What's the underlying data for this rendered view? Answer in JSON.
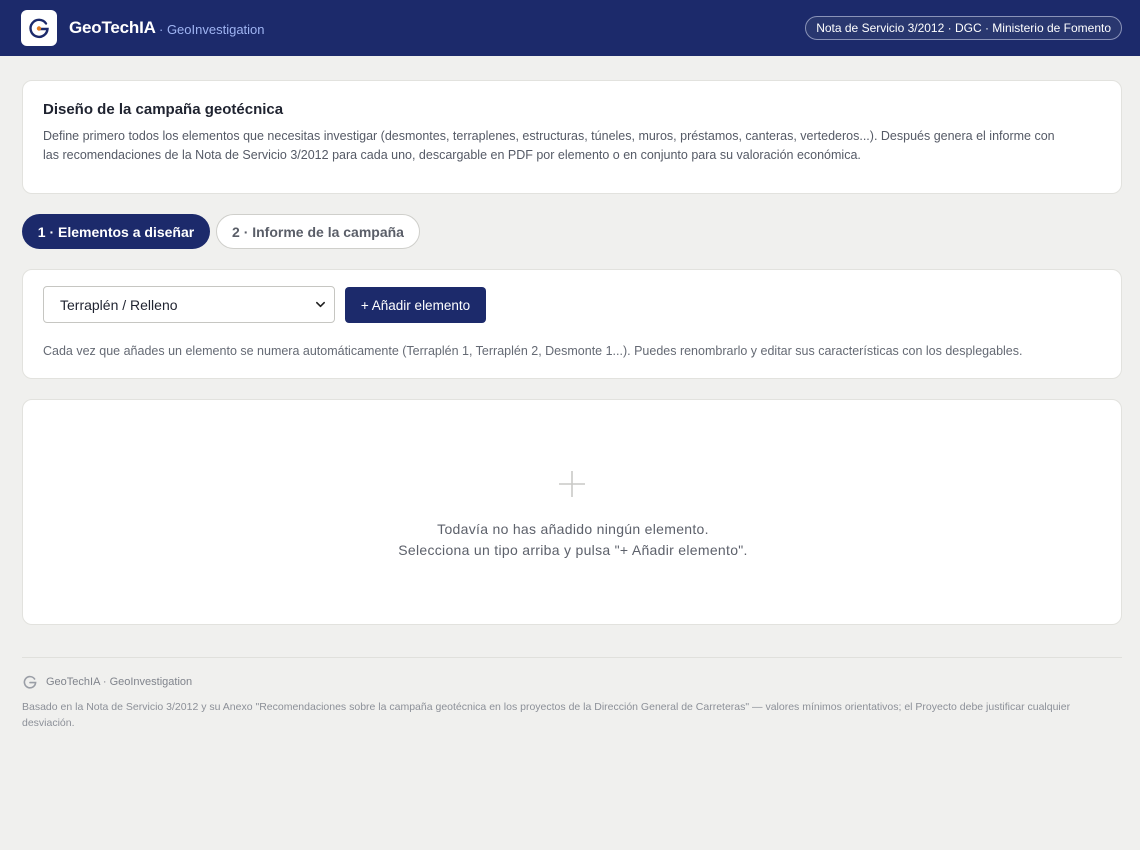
{
  "header": {
    "brand": "GeoTechIA",
    "subbrand": "· GeoInvestigation",
    "reference_badge": "Nota de Servicio 3/2012 · DGC · Ministerio de Fomento",
    "logo_icon": "geotechia-logo-icon"
  },
  "intro": {
    "title": "Diseño de la campaña geotécnica",
    "body": "Define primero todos los elementos que necesitas investigar (desmontes, terraplenes, estructuras, túneles, muros, préstamos, canteras, vertederos...). Después genera el informe con las recomendaciones de la Nota de Servicio 3/2012 para cada uno, descargable en PDF por elemento o en conjunto para su valoración económica."
  },
  "tabs": [
    {
      "label": "1 · Elementos a diseñar",
      "active": true
    },
    {
      "label": "2 · Informe de la campaña",
      "active": false
    }
  ],
  "adder": {
    "select_value": "Terraplén / Relleno",
    "add_button": "+ Añadir elemento",
    "hint": "Cada vez que añades un elemento se numera automáticamente (Terraplén 1, Terraplén 2, Desmonte 1...). Puedes renombrarlo y editar sus características con los desplegables."
  },
  "empty_state": {
    "icon": "plus-icon",
    "line1": "Todavía no has añadido ningún elemento.",
    "line2": "Selecciona un tipo arriba y pulsa \"+ Añadir elemento\"."
  },
  "footer": {
    "brand": "GeoTechIA · GeoInvestigation",
    "disclaimer": "Basado en la Nota de Servicio 3/2012 y su Anexo \"Recomendaciones sobre la campaña geotécnica en los proyectos de la Dirección General de Carreteras\" — valores mínimos orientativos; el Proyecto debe justificar cualquier desviación."
  },
  "colors": {
    "primary": "#1c2a6b",
    "accent_text": "#9fb4f2",
    "background": "#f0f0ee",
    "logo_orange": "#e07b1f"
  }
}
